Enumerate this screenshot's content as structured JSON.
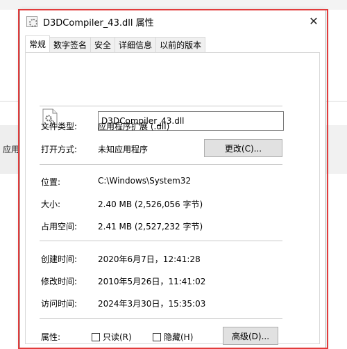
{
  "background": {
    "sidebar_text": "应用t"
  },
  "dialog": {
    "title": "D3DCompiler_43.dll 属性",
    "tabs": [
      "常规",
      "数字签名",
      "安全",
      "详细信息",
      "以前的版本"
    ],
    "active_tab": "常规",
    "filename": "D3DCompiler_43.dll",
    "file_type": {
      "label": "文件类型:",
      "value": "应用程序扩展 (.dll)"
    },
    "opens_with": {
      "label": "打开方式:",
      "value": "未知应用程序",
      "change_button": "更改(C)..."
    },
    "location": {
      "label": "位置:",
      "value": "C:\\Windows\\System32"
    },
    "size": {
      "label": "大小:",
      "value": "2.40 MB (2,526,056 字节)"
    },
    "size_on_disk": {
      "label": "占用空间:",
      "value": "2.41 MB (2,527,232 字节)"
    },
    "created": {
      "label": "创建时间:",
      "value": "2020年6月7日，12:41:28"
    },
    "modified": {
      "label": "修改时间:",
      "value": "2010年5月26日，11:41:02"
    },
    "accessed": {
      "label": "访问时间:",
      "value": "2024年3月30日，15:35:03"
    },
    "attributes": {
      "label": "属性:",
      "readonly": {
        "label": "只读(R)",
        "checked": false
      },
      "hidden": {
        "label": "隐藏(H)",
        "checked": false
      },
      "advanced_button": "高级(D)..."
    }
  },
  "colors": {
    "highlight_frame": "#e23b3b",
    "button_bg": "#e1e1e1"
  }
}
